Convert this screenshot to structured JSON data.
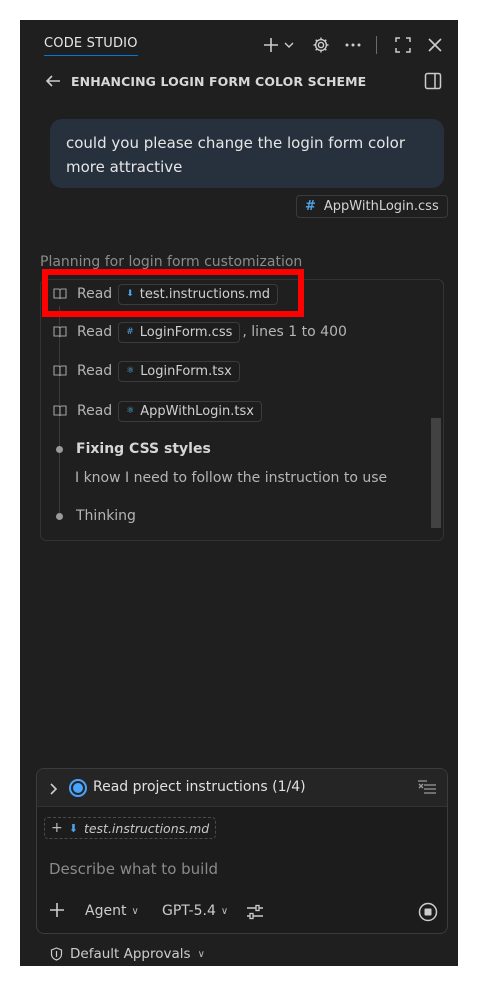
{
  "titlebar": {
    "app_title": "CODE STUDIO"
  },
  "header": {
    "title": "ENHANCING LOGIN FORM COLOR SCHEME"
  },
  "message": {
    "text": "could you please change the login form color more attractive",
    "attachment": "AppWithLogin.css"
  },
  "planning_text": "Planning for login form customization",
  "progress": {
    "read_label": "Read",
    "items": [
      {
        "file": "test.instructions.md",
        "suffix": ""
      },
      {
        "file": "LoginForm.css",
        "suffix": ", lines 1 to 400"
      },
      {
        "file": "LoginForm.tsx",
        "suffix": ""
      },
      {
        "file": "AppWithLogin.tsx",
        "suffix": ""
      }
    ],
    "step_title": "Fixing CSS styles",
    "step_detail": "I know I need to follow the instruction to use",
    "thinking": "Thinking"
  },
  "todo": {
    "label": "Read project instructions (1/4)"
  },
  "input": {
    "attachment": "test.instructions.md",
    "placeholder": "Describe what to build",
    "mode": "Agent",
    "model": "GPT-5.4"
  },
  "footer": {
    "approvals": "Default Approvals"
  },
  "colors": {
    "accent": "#0078d4",
    "highlight": "#ff0000",
    "radio": "#4aa3ff",
    "file_icon": "#4ea3e6"
  }
}
